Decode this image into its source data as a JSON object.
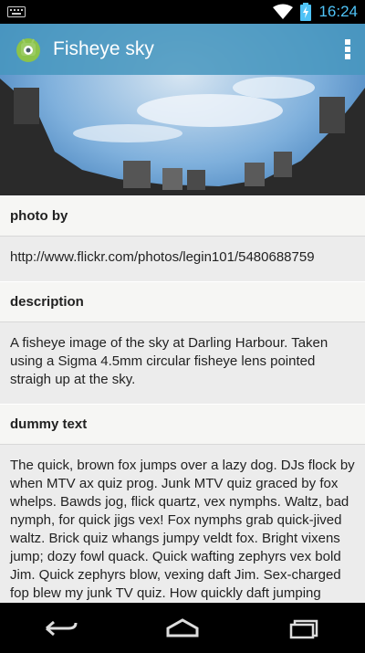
{
  "status_bar": {
    "time": "16:24",
    "icons": [
      "keyboard-icon",
      "wifi-icon",
      "battery-charging-icon"
    ]
  },
  "action_bar": {
    "title": "Fisheye sky",
    "icon": "android-app-icon",
    "overflow_icon": "overflow-menu-icon"
  },
  "sections": [
    {
      "header": "photo by",
      "body": "http://www.flickr.com/photos/legin101/5480688759"
    },
    {
      "header": "description",
      "body": "A fisheye image of the sky at Darling Harbour. Taken using a Sigma 4.5mm circular fisheye lens pointed straigh up at the sky."
    },
    {
      "header": "dummy text",
      "body": "The quick, brown fox jumps over a lazy dog. DJs flock by when MTV ax quiz prog. Junk MTV quiz graced by fox whelps. Bawds jog, flick quartz, vex nymphs. Waltz, bad nymph, for quick jigs vex! Fox nymphs grab quick-jived waltz. Brick quiz whangs jumpy veldt fox. Bright vixens jump; dozy fowl quack. Quick wafting zephyrs vex bold Jim. Quick zephyrs blow, vexing daft Jim. Sex-charged fop blew my junk TV quiz. How quickly daft jumping zebras vex. Two driven jocks help fax my big quiz. Quick, Baz, get my woven flax jodhpurs!"
    }
  ],
  "nav_bar": {
    "buttons": [
      "back-icon",
      "home-icon",
      "recent-apps-icon"
    ]
  },
  "colors": {
    "action_bar": "#4696be",
    "status_time": "#4fc3f7",
    "content_bg": "#ececec",
    "header_bg": "#f6f6f4"
  }
}
